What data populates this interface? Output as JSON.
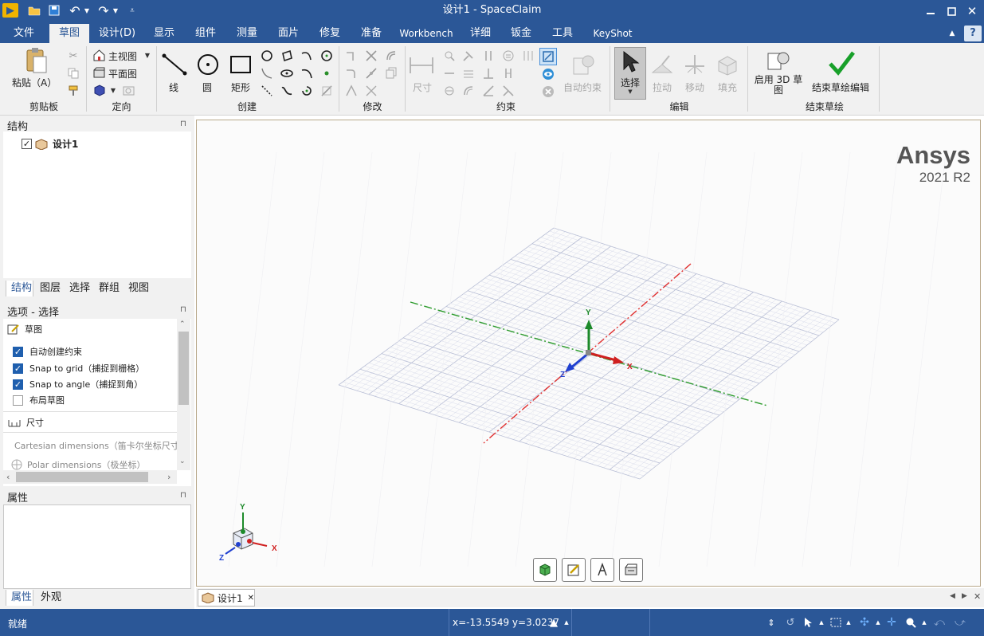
{
  "window": {
    "title": "设计1 - SpaceClaim"
  },
  "quick_access": {
    "save_icon": "save-icon",
    "open_icon": "folder-icon",
    "undo_icon": "undo-icon",
    "redo_icon": "redo-icon"
  },
  "menu": {
    "items": [
      "文件",
      "草图",
      "设计(D)",
      "显示",
      "组件",
      "测量",
      "面片",
      "修复",
      "准备",
      "Workbench",
      "详细",
      "钣金",
      "工具",
      "KeyShot"
    ],
    "active": "草图"
  },
  "ribbon": {
    "clipboard": {
      "paste_label": "粘贴（A）",
      "group": "剪贴板"
    },
    "orient": {
      "home_view": "主视图",
      "plan_view": "平面图",
      "group": "定向"
    },
    "create": {
      "line": "线",
      "circle": "圆",
      "rectangle": "矩形",
      "group": "创建"
    },
    "modify": {
      "group": "修改"
    },
    "constraints": {
      "dimension": "尺寸",
      "auto_constraint": "自动约束",
      "group": "约束"
    },
    "edit": {
      "select": "选择",
      "pull": "拉动",
      "move": "移动",
      "fill": "填充",
      "group": "编辑"
    },
    "end_sketch": {
      "enable_3d": "启用 3D 草图",
      "end_edit": "结束草绘编辑",
      "group": "结束草绘"
    }
  },
  "structure": {
    "title": "结构",
    "tree_item": "设计1",
    "tabs": [
      "结构",
      "图层",
      "选择",
      "群组",
      "视图"
    ]
  },
  "options": {
    "title": "选项 - 选择",
    "sketch_section": "草图",
    "items": [
      {
        "label": "自动创建约束",
        "checked": true
      },
      {
        "label": "Snap to grid（捕捉到栅格）",
        "checked": true
      },
      {
        "label": "Snap to angle（捕捉到角）",
        "checked": true
      },
      {
        "label": "布局草图",
        "checked": false
      }
    ],
    "dimension_section": "尺寸",
    "dimension_items": [
      "Cartesian dimensions（笛卡尔坐标尺寸",
      "Polar dimensions（极坐标）"
    ]
  },
  "properties": {
    "title": "属性",
    "tabs": [
      "属性",
      "外观"
    ]
  },
  "viewport": {
    "brand": "Ansys",
    "version": "2021 R2",
    "axis_x": "X",
    "axis_y": "Y",
    "axis_z": "Z"
  },
  "doc_tab": {
    "label": "设计1"
  },
  "status": {
    "text": "就绪",
    "coords": "x=-13.5549  y=3.0237"
  },
  "colors": {
    "chrome": "#2b5797",
    "ribbon": "#f1f1f1",
    "accent_check": "#1f5fae",
    "x_axis": "#e02020",
    "y_axis": "#1a8f2a",
    "z_axis": "#2040d0"
  }
}
